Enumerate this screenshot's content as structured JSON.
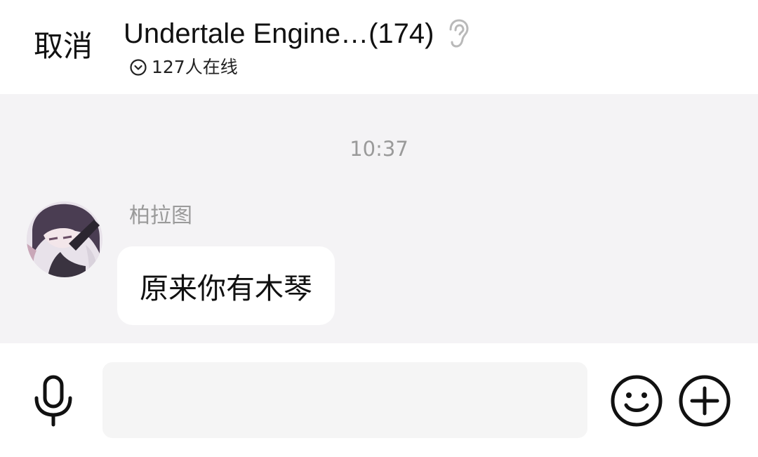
{
  "header": {
    "cancel_label": "取消",
    "group_title": "Undertale Engine…(174)",
    "online_text": "127人在线",
    "listen_icon": "ear-icon",
    "online_icon": "chevron-down-circle-icon"
  },
  "chat": {
    "timestamp": "10:37",
    "messages": [
      {
        "sender": "柏拉图",
        "text": "原来你有木琴",
        "avatar_icon": "anime-avatar"
      }
    ]
  },
  "input_bar": {
    "voice_icon": "microphone-icon",
    "input_value": "",
    "emoji_icon": "smiley-icon",
    "more_icon": "plus-circle-icon"
  },
  "colors": {
    "chat_background": "#f4f3f5",
    "bubble": "#ffffff",
    "muted_text": "#9a9a9a",
    "input_field": "#f5f5f5"
  }
}
